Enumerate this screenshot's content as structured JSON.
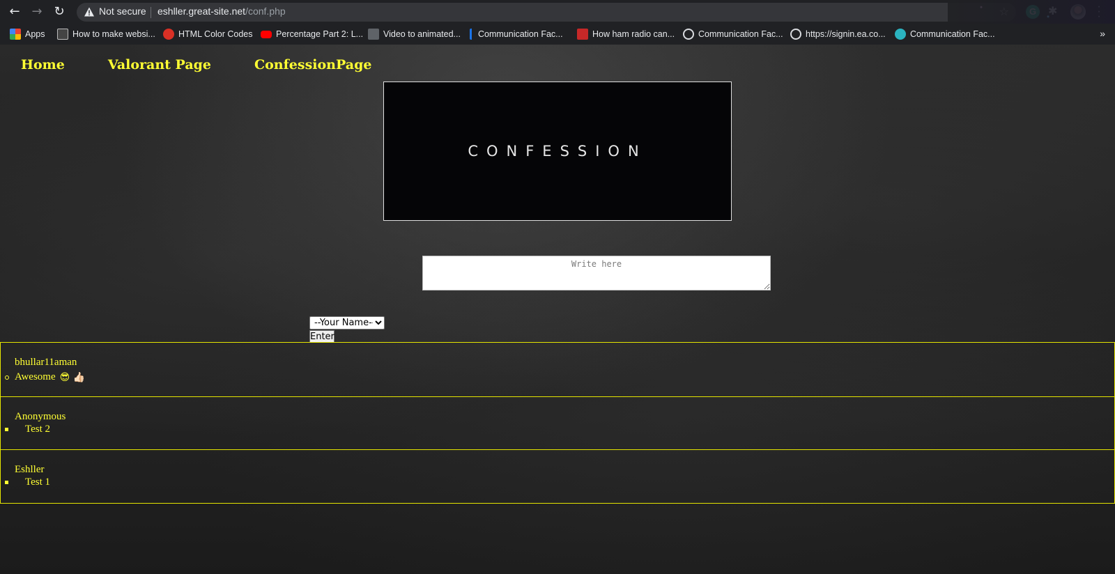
{
  "browser": {
    "security_label": "Not secure",
    "url_host": "eshller.great-site.net",
    "url_path": "/conf.php",
    "bookmarks": [
      {
        "label": "Apps",
        "icon": "apps-grid-icon",
        "color": "#e94235"
      },
      {
        "label": "How to make websi...",
        "icon": "site-favicon",
        "color": "#444444"
      },
      {
        "label": "HTML Color Codes",
        "icon": "color-codes-icon",
        "color": "#d93025"
      },
      {
        "label": "Percentage Part 2: L...",
        "icon": "youtube-icon",
        "color": "#ff0000"
      },
      {
        "label": "Video to animated...",
        "icon": "video-favicon",
        "color": "#5f6368"
      },
      {
        "label": "Communication Fac...",
        "icon": "info-favicon",
        "color": "#1a73e8"
      },
      {
        "label": "How ham radio can...",
        "icon": "toi-icon",
        "color": "#c62828"
      },
      {
        "label": "Communication Fac...",
        "icon": "globe-icon",
        "color": "#9aa0a6"
      },
      {
        "label": "https://signin.ea.co...",
        "icon": "globe-icon",
        "color": "#9aa0a6"
      },
      {
        "label": "Communication Fac...",
        "icon": "site-favicon",
        "color": "#2bb3c0"
      }
    ],
    "more_label": "»"
  },
  "nav": {
    "home": "Home",
    "valorant": "Valorant Page",
    "confession": "ConfessionPage",
    "link_color": "#ffff33"
  },
  "banner": {
    "text": "CONFESSION"
  },
  "form": {
    "placeholder": "Write here",
    "name_select": "--Your Name--",
    "submit_label": "Enter"
  },
  "posts": [
    {
      "author": "bhullar11aman",
      "text": "Awesome",
      "emoji": "😎 👍🏻",
      "bullet": "circle"
    },
    {
      "author": "Anonymous",
      "text": "Test 2",
      "bullet": "square"
    },
    {
      "author": "Eshller",
      "text": "Test 1",
      "bullet": "square"
    }
  ]
}
